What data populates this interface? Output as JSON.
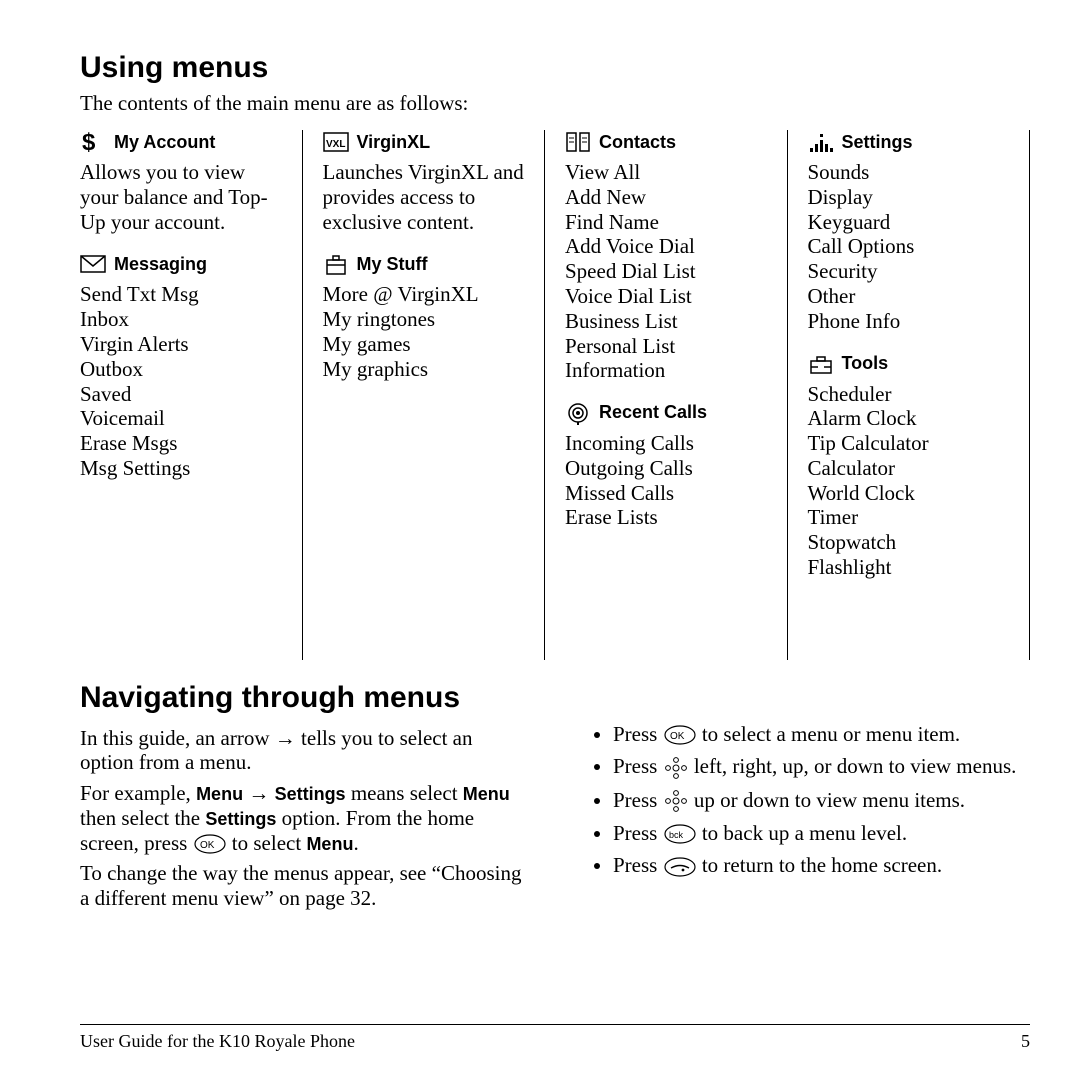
{
  "headings": {
    "using": "Using menus",
    "using_lead": "The contents of the main menu are as follows:",
    "navigating": "Navigating through menus"
  },
  "menus": [
    [
      {
        "icon": "dollar-icon",
        "title": "My Account",
        "desc": "Allows you to view your balance and Top-Up your account."
      },
      {
        "icon": "envelope-icon",
        "title": "Messaging",
        "items": [
          "Send Txt Msg",
          "Inbox",
          "Virgin Alerts",
          "Outbox",
          "Saved",
          "Voicemail",
          "Erase Msgs",
          "Msg Settings"
        ]
      }
    ],
    [
      {
        "icon": "vxl-icon",
        "title": "VirginXL",
        "desc": "Launches VirginXL and provides access to exclusive content."
      },
      {
        "icon": "bag-icon",
        "title": "My Stuff",
        "items": [
          "More @ VirginXL",
          "My ringtones",
          "My games",
          "My graphics"
        ]
      }
    ],
    [
      {
        "icon": "contacts-icon",
        "title": "Contacts",
        "items": [
          "View All",
          "Add New",
          "Find Name",
          "Add Voice Dial",
          "Speed Dial List",
          "Voice Dial List",
          "Business List",
          "Personal List",
          "Information"
        ]
      },
      {
        "icon": "recent-icon",
        "title": "Recent Calls",
        "items": [
          "Incoming Calls",
          "Outgoing Calls",
          "Missed Calls",
          "Erase Lists"
        ]
      }
    ],
    [
      {
        "icon": "settings-icon",
        "title": "Settings",
        "items": [
          "Sounds",
          "Display",
          "Keyguard",
          "Call Options",
          "Security",
          "Other",
          "Phone Info"
        ]
      },
      {
        "icon": "tools-icon",
        "title": "Tools",
        "items": [
          "Scheduler",
          "Alarm Clock",
          "Tip Calculator",
          "Calculator",
          "World Clock",
          "Timer",
          "Stopwatch",
          "Flashlight"
        ]
      }
    ]
  ],
  "nav_left": {
    "p1_a": "In this guide, an arrow ",
    "p1_b": " tells you to select an option from a menu.",
    "p2_a": "For example, ",
    "p2_menu": "Menu",
    "p2_arrow": " → ",
    "p2_settings": "Settings",
    "p2_b": " means select ",
    "p2_c": " then select the ",
    "p2_d": " option. From the home screen, press ",
    "p2_e": " to select ",
    "p2_f": ".",
    "p3": "To change the way the menus appear, see “Choosing a different menu view” on page 32."
  },
  "nav_right": {
    "b1_a": "Press ",
    "b1_b": " to select a menu or menu item.",
    "b2_a": "Press ",
    "b2_b": " left, right, up, or down to view menus.",
    "b3_a": "Press ",
    "b3_b": " up or down to view menu items.",
    "b4_a": "Press ",
    "b4_b": " to back up a menu level.",
    "b5_a": "Press ",
    "b5_b": " to return to the home screen."
  },
  "footer": {
    "left": "User Guide for the K10 Royale Phone",
    "right": "5"
  }
}
